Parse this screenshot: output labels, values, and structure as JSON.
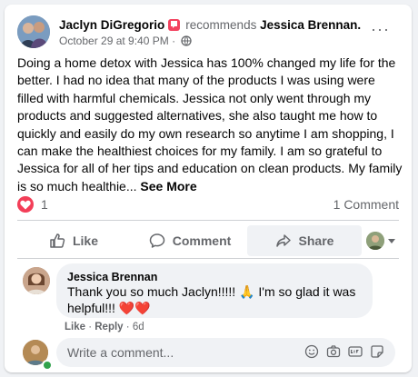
{
  "post": {
    "author": "Jaclyn DiGregorio",
    "recommends_verb": "recommends",
    "recommended": "Jessica Brennan.",
    "timestamp": "October 29 at 9:40 PM",
    "separator": "·",
    "more_label": "···",
    "body": "Doing a home detox with Jessica has 100% changed my life for the better. I had no idea that many of the products I was using were filled with harmful chemicals. Jessica not only went through my products and suggested alternatives, she also taught me how to quickly and easily do my own research so anytime I am shopping, I can make the healthiest choices for my family. I am so grateful to Jessica for all of her tips and education on clean products. My family is so much healthie...",
    "see_more": "See More"
  },
  "stats": {
    "reaction_count": "1",
    "comment_count": "1 Comment"
  },
  "actions": {
    "like": "Like",
    "comment": "Comment",
    "share": "Share"
  },
  "comment": {
    "author": "Jessica Brennan",
    "text": "Thank you so much Jaclyn!!!!! 🙏 I'm so glad it was helpful!!! ❤️❤️",
    "like_label": "Like",
    "reply_label": "Reply",
    "age": "6d"
  },
  "composer": {
    "placeholder": "Write a comment..."
  },
  "colors": {
    "accent_heart": "#f33e58",
    "recommend_badge": "#f3425f",
    "muted_text": "#65676b"
  },
  "icons": [
    "recommend-icon",
    "globe-icon",
    "more-icon",
    "heart-icon",
    "like-icon",
    "comment-icon",
    "share-icon",
    "smiley-icon",
    "camera-icon",
    "gif-icon",
    "sticker-icon"
  ]
}
